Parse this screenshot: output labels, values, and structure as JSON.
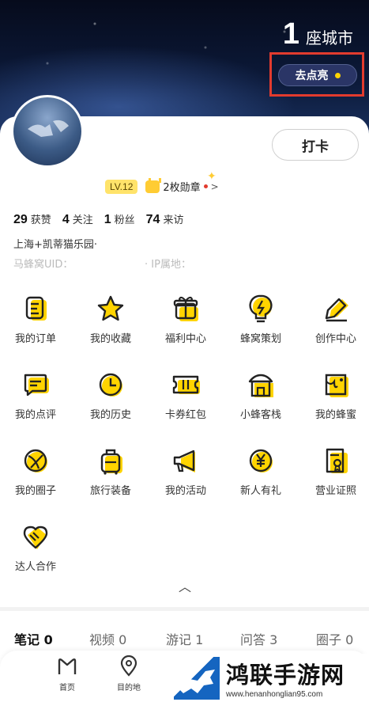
{
  "header": {
    "city_count": "1",
    "city_unit": "座城市",
    "light_up_label": "去点亮"
  },
  "profile": {
    "checkin_label": "打卡",
    "level": "LV.12",
    "medal_label": "2枚勋章",
    "stats": [
      {
        "value": "29",
        "label": "获赞"
      },
      {
        "value": "4",
        "label": "关注"
      },
      {
        "value": "1",
        "label": "粉丝"
      },
      {
        "value": "74",
        "label": "来访"
      }
    ],
    "location": "上海+凯蒂猫乐园·",
    "uid_label": "马蜂窝UID：",
    "ip_label": "· IP属地："
  },
  "menu": [
    {
      "label": "我的订单",
      "icon": "order-icon"
    },
    {
      "label": "我的收藏",
      "icon": "star-icon"
    },
    {
      "label": "福利中心",
      "icon": "gift-icon"
    },
    {
      "label": "蜂窝策划",
      "icon": "bulb-icon"
    },
    {
      "label": "创作中心",
      "icon": "pen-icon"
    },
    {
      "label": "我的点评",
      "icon": "comment-icon"
    },
    {
      "label": "我的历史",
      "icon": "clock-icon"
    },
    {
      "label": "卡券红包",
      "icon": "ticket-icon"
    },
    {
      "label": "小蜂客栈",
      "icon": "inn-icon"
    },
    {
      "label": "我的蜂蜜",
      "icon": "honey-icon"
    },
    {
      "label": "我的圈子",
      "icon": "circle-icon"
    },
    {
      "label": "旅行装备",
      "icon": "luggage-icon"
    },
    {
      "label": "我的活动",
      "icon": "megaphone-icon"
    },
    {
      "label": "新人有礼",
      "icon": "coin-icon"
    },
    {
      "label": "营业证照",
      "icon": "license-icon"
    },
    {
      "label": "达人合作",
      "icon": "handshake-icon"
    }
  ],
  "tabs": [
    {
      "label": "笔记 0",
      "active": true
    },
    {
      "label": "视频 0",
      "active": false
    },
    {
      "label": "游记 1",
      "active": false
    },
    {
      "label": "问答 3",
      "active": false
    },
    {
      "label": "圈子 0",
      "active": false
    }
  ],
  "bottom_nav": [
    {
      "label": "首页",
      "icon": "home-icon"
    },
    {
      "label": "目的地",
      "icon": "location-pin-icon"
    }
  ],
  "watermark": {
    "title": "鸿联手游网",
    "url": "www.henanhonglian95.com"
  },
  "colors": {
    "accent_yellow": "#ffd400",
    "highlight_red": "#e23b2e",
    "header_navy": "#0c1a3a"
  }
}
